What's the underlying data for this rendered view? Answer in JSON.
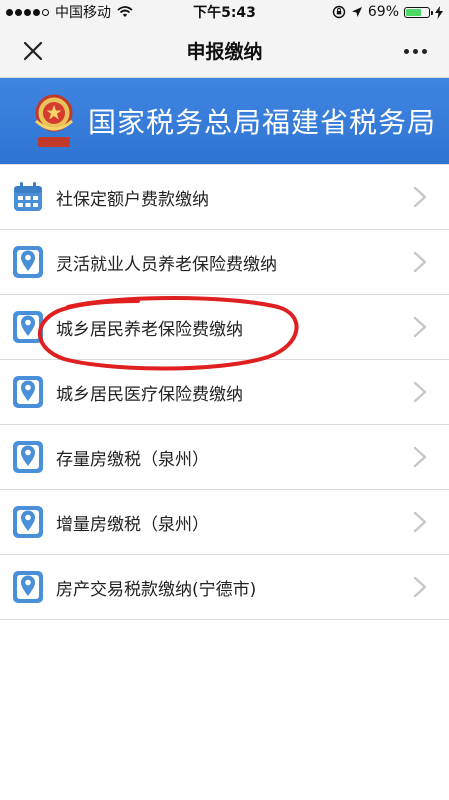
{
  "status_bar": {
    "carrier": "中国移动",
    "time": "下午5:43",
    "battery_percent": "69%",
    "battery_level": 0.69
  },
  "nav": {
    "title": "申报缴纳",
    "close_icon": "close-icon",
    "more_icon": "more-icon"
  },
  "banner": {
    "title": "国家税务总局福建省税务局",
    "emblem_icon": "tax-emblem-icon"
  },
  "menu": {
    "items": [
      {
        "label": "社保定额户费款缴纳",
        "icon": "calendar-icon"
      },
      {
        "label": "灵活就业人员养老保险费缴纳",
        "icon": "location-pin-icon"
      },
      {
        "label": "城乡居民养老保险费缴纳",
        "icon": "location-pin-icon"
      },
      {
        "label": "城乡居民医疗保险费缴纳",
        "icon": "location-pin-icon"
      },
      {
        "label": "存量房缴税（泉州）",
        "icon": "location-pin-icon"
      },
      {
        "label": "增量房缴税（泉州）",
        "icon": "location-pin-icon"
      },
      {
        "label": "房产交易税款缴纳(宁德市)",
        "icon": "location-pin-icon"
      }
    ]
  },
  "colors": {
    "banner_blue": "#3379d8",
    "icon_blue": "#4a90d9",
    "highlight_red": "#e02020",
    "chevron_gray": "#c7c7cc"
  }
}
